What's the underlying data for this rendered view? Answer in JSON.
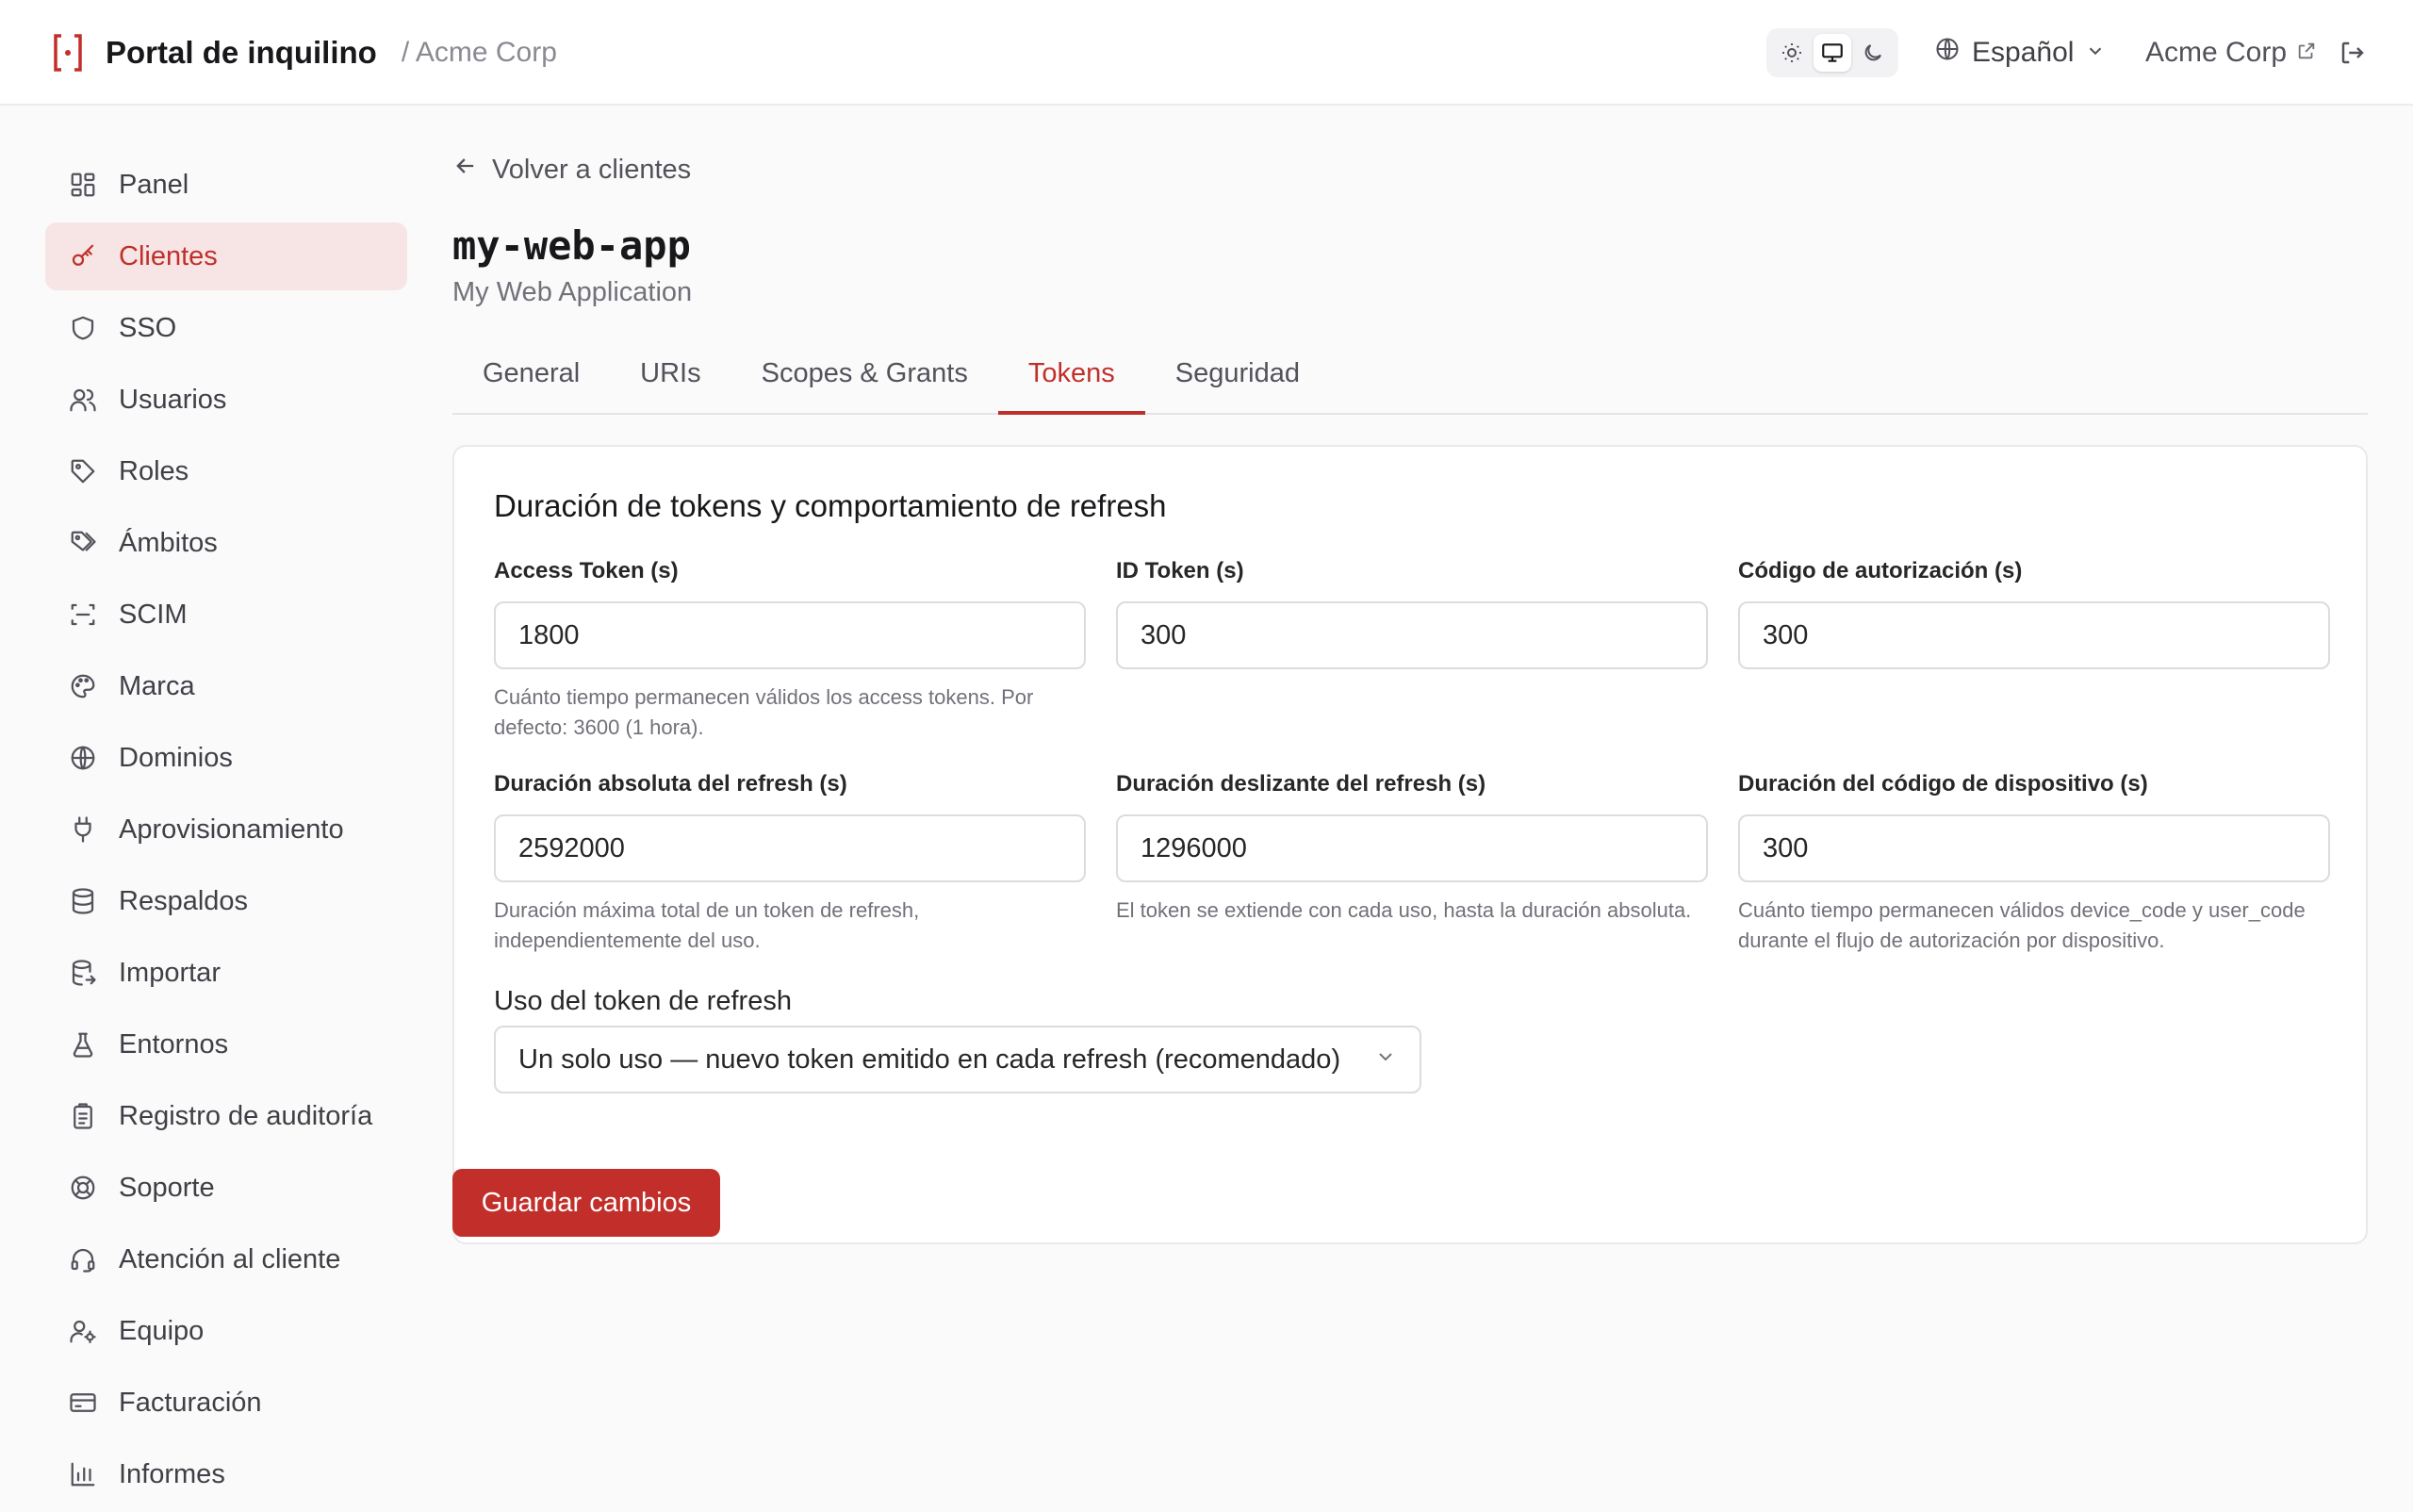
{
  "header": {
    "title": "Portal de inquilino",
    "tenant": "/ Acme Corp",
    "language": "Español",
    "org": "Acme Corp",
    "theme_icons": [
      "sun-icon",
      "monitor-icon",
      "moon-icon"
    ],
    "active_theme": "monitor"
  },
  "sidebar": {
    "items": [
      {
        "label": "Panel",
        "icon": "dashboard-icon"
      },
      {
        "label": "Clientes",
        "icon": "key-icon",
        "active": true
      },
      {
        "label": "SSO",
        "icon": "shield-icon"
      },
      {
        "label": "Usuarios",
        "icon": "users-icon"
      },
      {
        "label": "Roles",
        "icon": "tag-icon"
      },
      {
        "label": "Ámbitos",
        "icon": "tags-icon"
      },
      {
        "label": "SCIM",
        "icon": "scan-icon"
      },
      {
        "label": "Marca",
        "icon": "palette-icon"
      },
      {
        "label": "Dominios",
        "icon": "globe-icon"
      },
      {
        "label": "Aprovisionamiento",
        "icon": "plug-icon"
      },
      {
        "label": "Respaldos",
        "icon": "database-icon"
      },
      {
        "label": "Importar",
        "icon": "database-import-icon"
      },
      {
        "label": "Entornos",
        "icon": "flask-icon"
      },
      {
        "label": "Registro de auditoría",
        "icon": "clipboard-icon"
      },
      {
        "label": "Soporte",
        "icon": "lifebuoy-icon"
      },
      {
        "label": "Atención al cliente",
        "icon": "headset-icon"
      },
      {
        "label": "Equipo",
        "icon": "user-cog-icon"
      },
      {
        "label": "Facturación",
        "icon": "credit-card-icon"
      },
      {
        "label": "Informes",
        "icon": "bar-chart-icon"
      }
    ]
  },
  "main": {
    "back_label": "Volver a clientes",
    "client_id": "my-web-app",
    "client_name": "My Web Application",
    "tabs": [
      {
        "label": "General"
      },
      {
        "label": "URIs"
      },
      {
        "label": "Scopes & Grants"
      },
      {
        "label": "Tokens",
        "active": true
      },
      {
        "label": "Seguridad"
      }
    ],
    "card_title": "Duración de tokens y comportamiento de refresh",
    "fields": [
      {
        "label": "Access Token (s)",
        "value": "1800",
        "help": "Cuánto tiempo permanecen válidos los access tokens. Por defecto: 3600 (1 hora)."
      },
      {
        "label": "ID Token (s)",
        "value": "300",
        "help": ""
      },
      {
        "label": "Código de autorización (s)",
        "value": "300",
        "help": ""
      },
      {
        "label": "Duración absoluta del refresh (s)",
        "value": "2592000",
        "help": "Duración máxima total de un token de refresh, independientemente del uso."
      },
      {
        "label": "Duración deslizante del refresh (s)",
        "value": "1296000",
        "help": "El token se extiende con cada uso, hasta la duración absoluta."
      },
      {
        "label": "Duración del código de dispositivo (s)",
        "value": "300",
        "help": "Cuánto tiempo permanecen válidos device_code y user_code durante el flujo de autorización por dispositivo."
      }
    ],
    "refresh_usage_label": "Uso del token de refresh",
    "refresh_usage_value": "Un solo uso — nuevo token emitido en cada refresh (recomendado)",
    "save_label": "Guardar cambios"
  },
  "colors": {
    "accent": "#c22f2a",
    "active_bg": "#f7e5e5"
  }
}
